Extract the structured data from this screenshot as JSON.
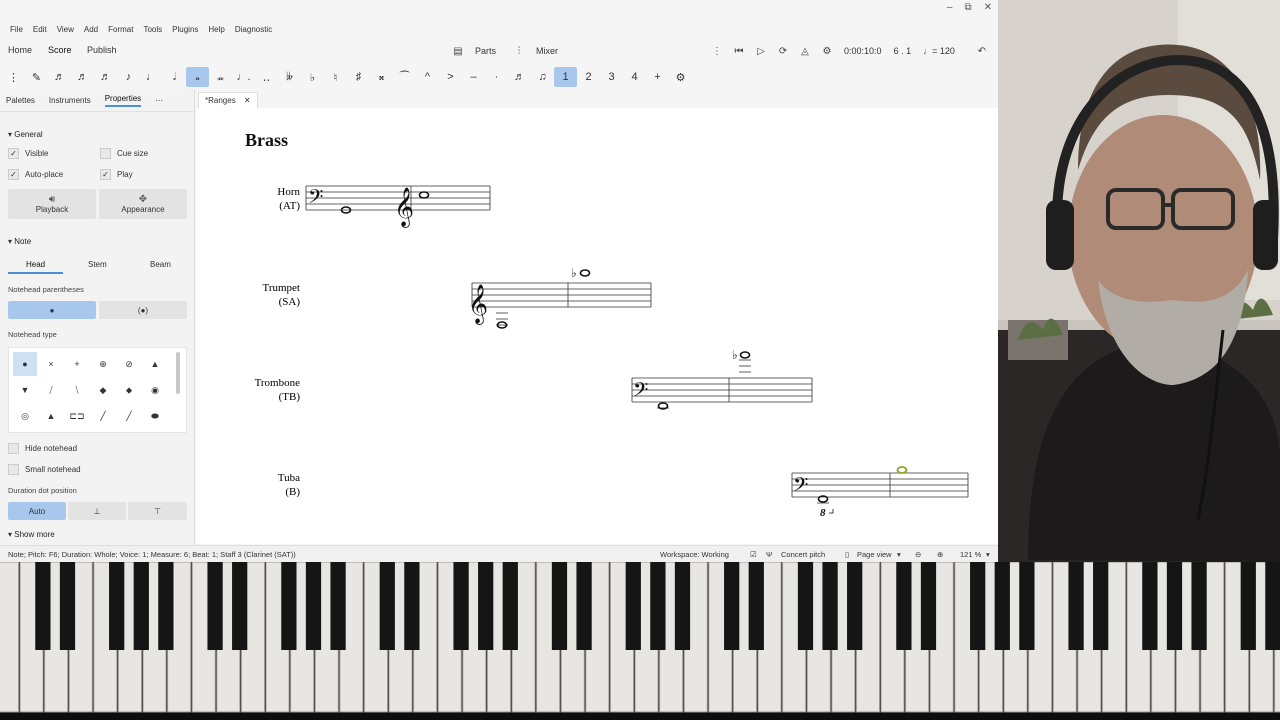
{
  "menu": [
    "File",
    "Edit",
    "View",
    "Add",
    "Format",
    "Tools",
    "Plugins",
    "Help",
    "Diagnostic"
  ],
  "main_tabs": {
    "home": "Home",
    "score": "Score",
    "publish": "Publish"
  },
  "transport": {
    "parts": "Parts",
    "mixer": "Mixer",
    "time": "0:00:10:0",
    "position": "6 . 1",
    "tempo": "= 120"
  },
  "panel": {
    "tabs": {
      "palettes": "Palettes",
      "instruments": "Instruments",
      "properties": "Properties"
    },
    "general": {
      "title": "General",
      "visible": "Visible",
      "cue_size": "Cue size",
      "auto_place": "Auto-place",
      "play": "Play",
      "playback": "Playback",
      "appearance": "Appearance"
    },
    "note": {
      "title": "Note",
      "head": "Head",
      "stem": "Stem",
      "beam": "Beam",
      "parentheses_label": "Notehead parentheses",
      "type_label": "Notehead type",
      "hide": "Hide notehead",
      "small": "Small notehead",
      "dot_label": "Duration dot position",
      "auto": "Auto"
    },
    "show_more": "Show more"
  },
  "score": {
    "tab_label": "*Ranges",
    "title": "Brass",
    "instruments": [
      {
        "name": "Horn",
        "range": "(AT)"
      },
      {
        "name": "Trumpet",
        "range": "(SA)"
      },
      {
        "name": "Trombone",
        "range": "(TB)"
      },
      {
        "name": "Tuba",
        "range": "(B)"
      }
    ],
    "ottava": "8"
  },
  "status": {
    "left": "Note; Pitch: F6; Duration: Whole; Voice: 1; Measure: 6; Beat: 1; Staff 3 (Clarinet (SAT))",
    "workspace": "Workspace: Working",
    "concert_pitch": "Concert pitch",
    "page_view": "Page view",
    "zoom": "121 %"
  },
  "colors": {
    "accent": "#a7c8ec",
    "selected_note": "#8aa820"
  }
}
